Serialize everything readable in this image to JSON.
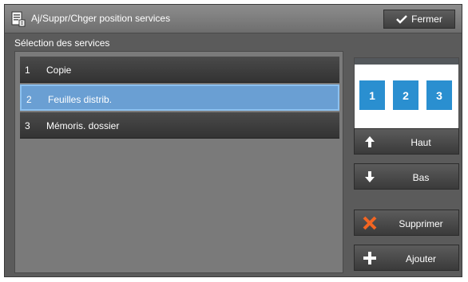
{
  "header": {
    "title": "Aj/Suppr/Chger position services",
    "close_label": "Fermer",
    "icons": {
      "title": "document-icon",
      "close": "checkmark-icon"
    }
  },
  "main": {
    "section_label": "Sélection des services",
    "rows": [
      {
        "num": "1",
        "label": "Copie",
        "selected": false
      },
      {
        "num": "2",
        "label": "Feuilles distrib.",
        "selected": true
      },
      {
        "num": "3",
        "label": "Mémoris. dossier",
        "selected": false
      }
    ]
  },
  "preview": {
    "tiles": [
      "1",
      "2",
      "3"
    ],
    "color": "#2a8fd0"
  },
  "actions": {
    "up_label": "Haut",
    "down_label": "Bas",
    "delete_label": "Supprimer",
    "add_label": "Ajouter",
    "colors": {
      "delete": "#f26522",
      "selected_row": "#6a9fd3"
    }
  }
}
